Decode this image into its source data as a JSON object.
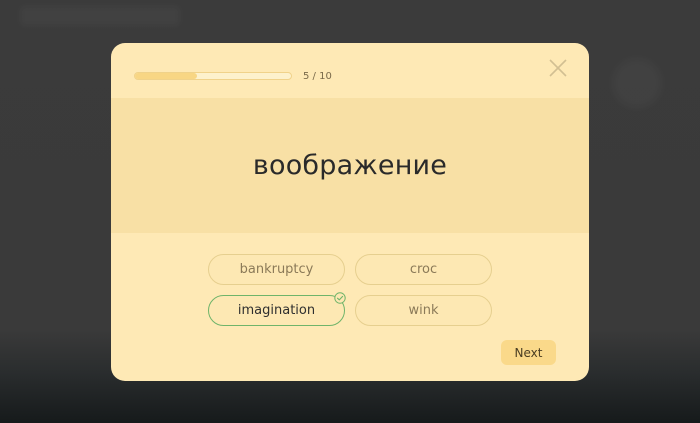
{
  "quiz": {
    "progress": {
      "current": 5,
      "total": 10,
      "fraction": 0.4,
      "label": "5 / 10"
    },
    "word": "воображение",
    "answers": [
      {
        "label": "bankruptcy",
        "correct": false
      },
      {
        "label": "croc",
        "correct": false
      },
      {
        "label": "imagination",
        "correct": true
      },
      {
        "label": "wink",
        "correct": false
      }
    ],
    "next_label": "Next"
  },
  "icons": {
    "close": "close-icon",
    "correct": "check-circle-icon"
  },
  "colors": {
    "modal_background": "#fee9b5",
    "word_panel": "#f8e0a5",
    "progress_fill": "#f8d684",
    "correct_border": "#6fb46a",
    "next_button": "#fad98a"
  }
}
